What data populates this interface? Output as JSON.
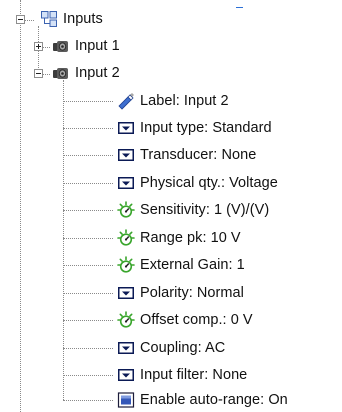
{
  "tree": {
    "root": {
      "label": "Inputs",
      "icon": "grid-tree-icon",
      "expanded": true
    },
    "input1": {
      "label": "Input 1",
      "icon": "transducer-icon",
      "expanded": false
    },
    "input2": {
      "label": "Input 2",
      "icon": "transducer-icon",
      "expanded": true,
      "properties": [
        {
          "label": "Label: Input 2",
          "icon": "pencil-tag-icon"
        },
        {
          "label": "Input type: Standard",
          "icon": "dropdown-icon"
        },
        {
          "label": "Transducer: None",
          "icon": "dropdown-icon"
        },
        {
          "label": "Physical qty.: Voltage",
          "icon": "dropdown-icon"
        },
        {
          "label": "Sensitivity: 1 (V)/(V)",
          "icon": "green-dial-icon"
        },
        {
          "label": "Range pk: 10 V",
          "icon": "green-dial-icon"
        },
        {
          "label": "External Gain: 1",
          "icon": "green-dial-icon"
        },
        {
          "label": "Polarity: Normal",
          "icon": "dropdown-icon"
        },
        {
          "label": "Offset comp.: 0 V",
          "icon": "green-dial-icon"
        },
        {
          "label": "Coupling: AC",
          "icon": "dropdown-icon"
        },
        {
          "label": "Input filter: None",
          "icon": "dropdown-icon"
        },
        {
          "label": "Enable auto-range: On",
          "icon": "checkbox-checked-icon"
        }
      ]
    }
  },
  "colors": {
    "dropdown": "#0b1a55",
    "dial_green": "#39a52c",
    "tree_lines": "#8a8a8a",
    "checkbox_blue": "#3457b8"
  }
}
